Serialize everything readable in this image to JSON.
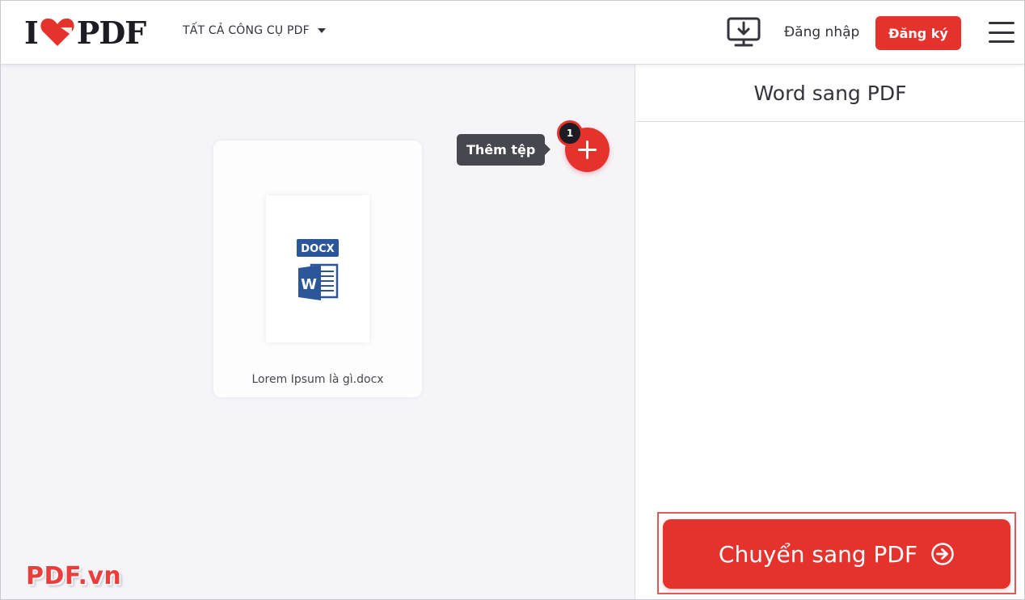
{
  "header": {
    "logo_left": "I",
    "logo_right": "PDF",
    "tools_menu_label": "TẤT CẢ CÔNG CỤ PDF",
    "login_label": "Đăng nhập",
    "signup_label": "Đăng ký"
  },
  "workspace": {
    "tooltip_label": "Thêm tệp",
    "file_count": "1",
    "file": {
      "type_label": "DOCX",
      "name": "Lorem Ipsum là gì.docx"
    },
    "watermark": "PDF.vn"
  },
  "sidebar": {
    "title": "Word sang PDF",
    "convert_label": "Chuyển sang PDF"
  },
  "colors": {
    "accent": "#e5322d",
    "word_blue": "#2b579a",
    "workspace_bg": "#f4f4f9"
  },
  "icons": {
    "logo_heart": "heart-icon",
    "desktop_download": "desktop-download-icon",
    "menu": "hamburger-icon",
    "add": "plus-icon",
    "file": "word-docx-icon",
    "convert_arrow": "arrow-right-circle-icon"
  }
}
